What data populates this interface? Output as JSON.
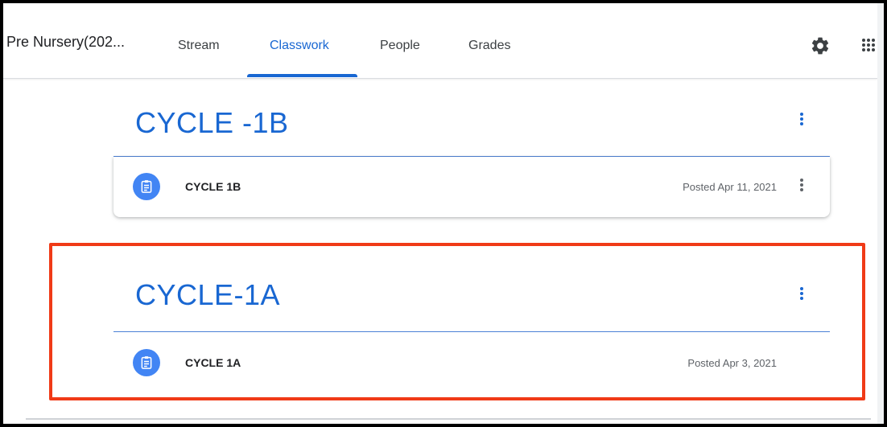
{
  "header": {
    "class_title": "Pre Nursery(202...",
    "tabs": [
      {
        "label": "Stream",
        "active": false
      },
      {
        "label": "Classwork",
        "active": true
      },
      {
        "label": "People",
        "active": false
      },
      {
        "label": "Grades",
        "active": false
      }
    ],
    "icons": [
      "settings-gear-icon",
      "apps-grid-icon"
    ]
  },
  "topics": [
    {
      "title": "CYCLE -1B",
      "items": [
        {
          "name": "CYCLE 1B",
          "posted": "Posted Apr 11, 2021",
          "icon": "assignment-icon"
        }
      ]
    },
    {
      "title": "CYCLE-1A",
      "highlighted": true,
      "items": [
        {
          "name": "CYCLE 1A",
          "posted": "Posted Apr 3, 2021",
          "icon": "assignment-icon"
        }
      ]
    }
  ],
  "colors": {
    "accent": "#1967d2",
    "icon_circle": "#4285f4",
    "highlight_box": "#f03a17"
  }
}
